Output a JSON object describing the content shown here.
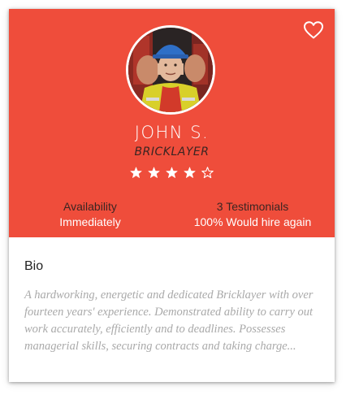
{
  "profile": {
    "name": "JOHN S.",
    "role": "BRICKLAYER",
    "rating": 4,
    "rating_max": 5
  },
  "stats": {
    "availability_label": "Availability",
    "availability_value": "Immediately",
    "testimonials_label": "3 Testimonials",
    "testimonials_value": "100% Would hire again"
  },
  "bio": {
    "title": "Bio",
    "text": "A hardworking, energetic and dedicated Bricklayer with over fourteen years' experience. Demonstrated ability to carry out work accurately, efficiently and to deadlines. Possesses managerial skills, securing contracts and taking charge..."
  },
  "icons": {
    "favorite": "heart-outline-icon",
    "star_full": "star-filled-icon",
    "star_empty": "star-outline-icon"
  },
  "colors": {
    "accent": "#ef4d3b",
    "label_dark": "#3b2522",
    "bio_text": "#a9a9a9"
  }
}
